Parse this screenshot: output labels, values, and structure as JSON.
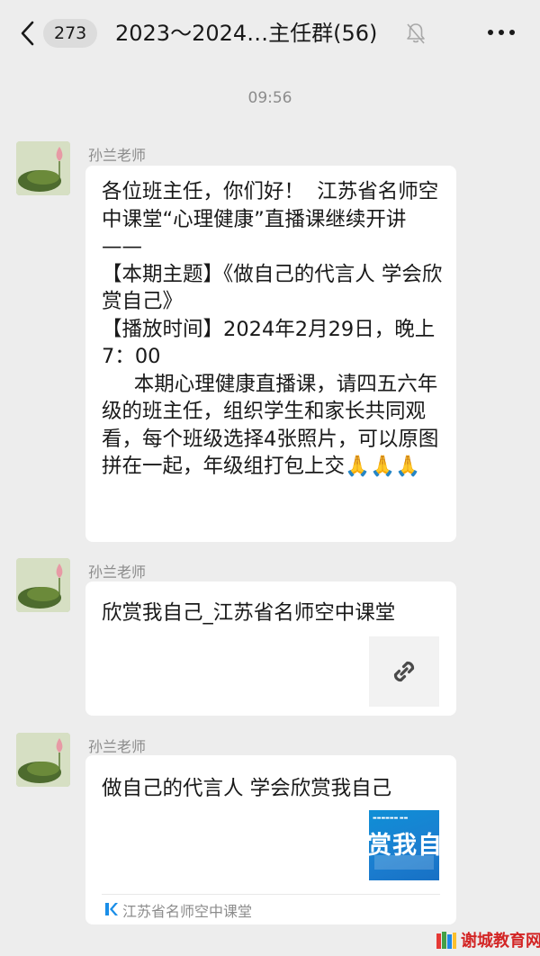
{
  "header": {
    "unread_count": "273",
    "title": "2023～2024…主任群(56)"
  },
  "timestamp": "09:56",
  "messages": [
    {
      "sender": "孙兰老师",
      "type": "text",
      "text": "各位班主任，你们好！  江苏省名师空中课堂“心理健康”直播课继续开讲——\n【本期主题】《做自己的代言人 学会欣赏自己》\n【播放时间】2024年2月29日，晚上7：00\n     本期心理健康直播课，请四五六年级的班主任，组织学生和家长共同观看，每个班级选择4张照片，可以原图拼在一起，年级组打包上交🙏🙏🙏"
    },
    {
      "sender": "孙兰老师",
      "type": "link",
      "title": "欣赏我自己_江苏省名师空中课堂",
      "thumb_icon": "link-icon"
    },
    {
      "sender": "孙兰老师",
      "type": "card",
      "title": "做自己的代言人 学会欣赏我自己",
      "thumb_text": "赏我自己",
      "source": "江苏省名师空中课堂",
      "source_icon": "k-logo-icon"
    }
  ],
  "watermark": "谢城教育网",
  "colors": {
    "background": "#ededed",
    "bubble": "#ffffff",
    "meta_text": "#8c8c8c",
    "thumb_blue": "#1b7ed0",
    "watermark_red": "#d32525",
    "source_blue": "#1a8ee8"
  }
}
